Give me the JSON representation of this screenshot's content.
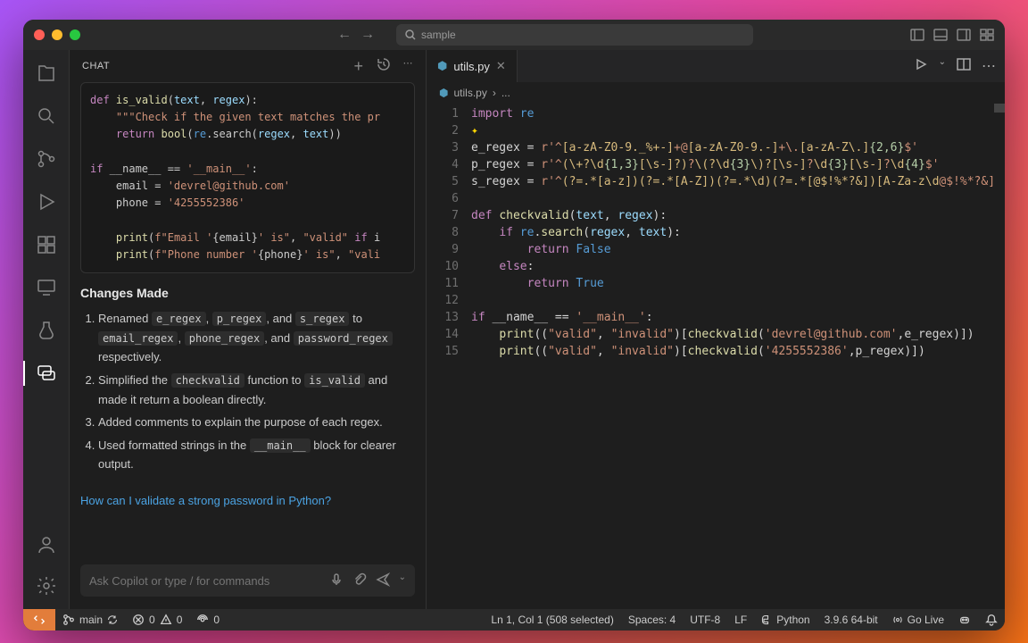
{
  "search": {
    "placeholder": "sample"
  },
  "chat": {
    "title": "CHAT",
    "code_preview": "def is_valid(text, regex):\n    \"\"\"Check if the given text matches the pr\n    return bool(re.search(regex, text))\n\nif __name__ == '__main__':\n    email = 'devrel@github.com'\n    phone = '4255552386'\n\n    print(f\"Email '{email}' is\", \"valid\" if i\n    print(f\"Phone number '{phone}' is\", \"vali",
    "changes_heading": "Changes Made",
    "changes": [
      {
        "pre": "Renamed ",
        "codes": [
          "e_regex",
          "p_regex",
          "s_regex"
        ],
        "mid": ", and ",
        "post": " to ",
        "codes2": [
          "email_regex",
          "phone_regex",
          "password_regex"
        ],
        "tail": " respectively."
      },
      {
        "pre": "Simplified the ",
        "codes": [
          "checkvalid"
        ],
        "mid": " function to ",
        "codes2": [
          "is_valid"
        ],
        "tail": " and made it return a boolean directly."
      },
      {
        "text": "Added comments to explain the purpose of each regex."
      },
      {
        "pre": "Used formatted strings in the ",
        "codes": [
          "__main__"
        ],
        "tail": " block for clearer output."
      }
    ],
    "followup": "How can I validate a strong password in Python?",
    "input_placeholder": "Ask Copilot or type / for commands"
  },
  "editor": {
    "tab_file": "utils.py",
    "breadcrumb_file": "utils.py",
    "breadcrumb_more": "...",
    "lines": [
      {
        "n": 1,
        "html": "<span class='kw'>import</span> <span class='bl'>re</span>"
      },
      {
        "n": 2,
        "html": "<span class='sparkle'>✦</span>"
      },
      {
        "n": 3,
        "html": "e_regex = <span class='st'>r'^</span><span class='rgx-br'>[a-zA-Z0-9._%+-]</span><span class='st'>+@</span><span class='rgx-br'>[a-zA-Z0-9.-]</span><span class='st'>+\\.</span><span class='rgx-br'>[a-zA-Z\\.]</span><span class='rgx-num'>{2,6}</span><span class='st'>$'</span>"
      },
      {
        "n": 4,
        "html": "p_regex = <span class='st'>r'^</span><span class='rgx-br'>(\\+?\\d</span><span class='rgx-num'>{1,3}</span><span class='rgx-br'>[\\s-]?)</span><span class='st'>?</span><span class='rgx-br'>\\(?\\d</span><span class='rgx-num'>{3}</span><span class='rgx-br'>\\)?[\\s-]</span><span class='st'>?</span><span class='rgx-br'>\\d</span><span class='rgx-num'>{3}</span><span class='rgx-br'>[\\s-]</span><span class='st'>?</span><span class='rgx-br'>\\d</span><span class='rgx-num'>{4}</span><span class='st'>$'</span>"
      },
      {
        "n": 5,
        "html": "s_regex = <span class='st'>r'^</span><span class='rgx-br'>(?=.*[a-z])(?=.*[A-Z])(?=.*\\d)(?=.*[@$!%*?&])[A-Za-z\\d</span><span class='st'>@$!%*?&]</span>"
      },
      {
        "n": 6,
        "html": ""
      },
      {
        "n": 7,
        "html": "<span class='kw'>def</span> <span class='fn'>checkvalid</span>(<span class='pr'>text</span>, <span class='pr'>regex</span>):"
      },
      {
        "n": 8,
        "html": "    <span class='kw'>if</span> <span class='bl'>re</span>.<span class='fn'>search</span>(<span class='pr'>regex</span>, <span class='pr'>text</span>):"
      },
      {
        "n": 9,
        "html": "        <span class='kw'>return</span> <span class='bl'>False</span>"
      },
      {
        "n": 10,
        "html": "    <span class='kw'>else</span>:"
      },
      {
        "n": 11,
        "html": "        <span class='kw'>return</span> <span class='bl'>True</span>"
      },
      {
        "n": 12,
        "html": ""
      },
      {
        "n": 13,
        "html": "<span class='kw'>if</span> __name__ == <span class='st'>'__main__'</span>:"
      },
      {
        "n": 14,
        "html": "    <span class='fn'>print</span>((<span class='st'>\"valid\"</span>, <span class='st'>\"invalid\"</span>)[<span class='fn'>checkvalid</span>(<span class='st'>'devrel@github.com'</span>,e_regex)])"
      },
      {
        "n": 15,
        "html": "    <span class='fn'>print</span>((<span class='st'>\"valid\"</span>, <span class='st'>\"invalid\"</span>)[<span class='fn'>checkvalid</span>(<span class='st'>'4255552386'</span>,p_regex)])"
      }
    ]
  },
  "status": {
    "branch": "main",
    "errors": "0",
    "warnings": "0",
    "ports": "0",
    "cursor": "Ln 1, Col 1 (508 selected)",
    "spaces": "Spaces: 4",
    "encoding": "UTF-8",
    "eol": "LF",
    "language": "Python",
    "python_version": "3.9.6 64-bit",
    "go_live": "Go Live"
  }
}
